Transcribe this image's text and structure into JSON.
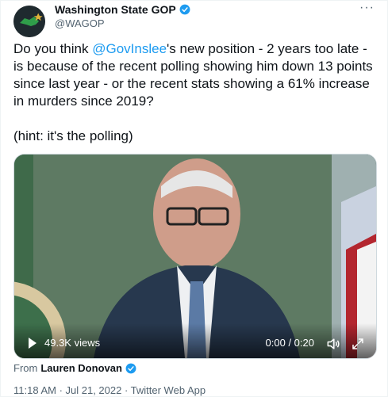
{
  "tweet": {
    "author_name": "Washington State GOP",
    "author_handle": "@WAGOP",
    "text_before": "Do you think ",
    "mention": "@GovInslee",
    "text_after": "'s new position - 2 years too late - is because of the recent polling showing him down 13 points since last year - or the recent stats showing a 61% increase in murders since 2019?\n\n(hint: it's the polling)",
    "more_label": "···"
  },
  "video": {
    "views": "49.3K views",
    "time": "0:00 / 0:20"
  },
  "attribution": {
    "prefix": "From",
    "name": "Lauren Donovan"
  },
  "meta": {
    "timestamp": "11:18 AM · Jul 21, 2022 · Twitter Web App"
  },
  "icons": {
    "verified": "verified-badge-icon",
    "more": "more-options-icon",
    "play": "play-icon",
    "volume": "volume-icon",
    "fullscreen": "fullscreen-icon"
  },
  "colors": {
    "accent": "#1d9bf0",
    "text": "#0f1419",
    "muted": "#536471"
  }
}
